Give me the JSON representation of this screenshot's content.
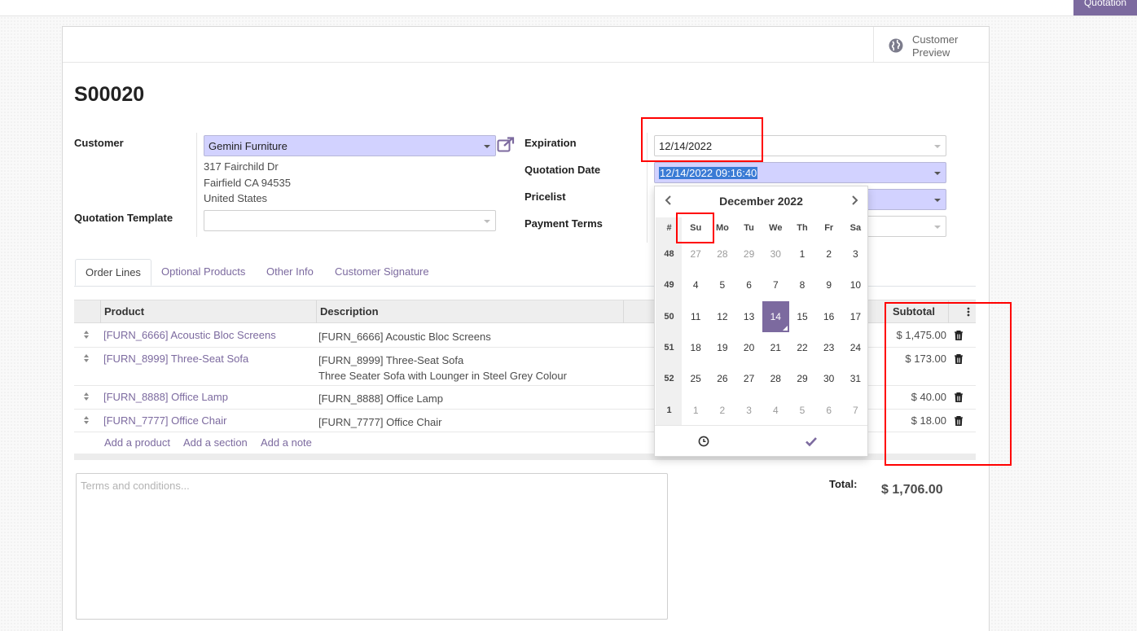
{
  "topbar": {
    "quotation_button": "Quotation"
  },
  "header": {
    "customer_preview": "Customer Preview"
  },
  "record": {
    "title": "S00020"
  },
  "form": {
    "customer_label": "Customer",
    "customer_value": "Gemini Furniture",
    "address": [
      "317 Fairchild Dr",
      "Fairfield CA 94535",
      "United States"
    ],
    "template_label": "Quotation Template",
    "template_value": "",
    "expiration_label": "Expiration",
    "expiration_value": "12/14/2022",
    "quotation_date_label": "Quotation Date",
    "quotation_date_value": "12/14/2022 09:16:40",
    "pricelist_label": "Pricelist",
    "payment_terms_label": "Payment Terms"
  },
  "tabs": [
    "Order Lines",
    "Optional Products",
    "Other Info",
    "Customer Signature"
  ],
  "table": {
    "headers": {
      "product": "Product",
      "description": "Description",
      "subtotal": "Subtotal"
    },
    "rows": [
      {
        "product": "[FURN_6666] Acoustic Bloc Screens",
        "description": "[FURN_6666] Acoustic Bloc Screens",
        "description2": "",
        "subtotal": "$ 1,475.00"
      },
      {
        "product": "[FURN_8999] Three-Seat Sofa",
        "description": "[FURN_8999] Three-Seat Sofa",
        "description2": "Three Seater Sofa with Lounger in Steel Grey Colour",
        "subtotal": "$ 173.00"
      },
      {
        "product": "[FURN_8888] Office Lamp",
        "description": "[FURN_8888] Office Lamp",
        "description2": "",
        "subtotal": "$ 40.00"
      },
      {
        "product": "[FURN_7777] Office Chair",
        "description": "[FURN_7777] Office Chair",
        "description2": "",
        "subtotal": "$ 18.00"
      }
    ],
    "add_product": "Add a product",
    "add_section": "Add a section",
    "add_note": "Add a note"
  },
  "terms": {
    "placeholder": "Terms and conditions..."
  },
  "totals": {
    "label": "Total:",
    "value": "$ 1,706.00"
  },
  "datepicker": {
    "title": "December 2022",
    "week_header": "#",
    "days_of_week": [
      "Su",
      "Mo",
      "Tu",
      "We",
      "Th",
      "Fr",
      "Sa"
    ],
    "weeks": [
      {
        "num": "48",
        "days": [
          "27",
          "28",
          "29",
          "30",
          "1",
          "2",
          "3"
        ]
      },
      {
        "num": "49",
        "days": [
          "4",
          "5",
          "6",
          "7",
          "8",
          "9",
          "10"
        ]
      },
      {
        "num": "50",
        "days": [
          "11",
          "12",
          "13",
          "14",
          "15",
          "16",
          "17"
        ]
      },
      {
        "num": "51",
        "days": [
          "18",
          "19",
          "20",
          "21",
          "22",
          "23",
          "24"
        ]
      },
      {
        "num": "52",
        "days": [
          "25",
          "26",
          "27",
          "28",
          "29",
          "30",
          "31"
        ]
      },
      {
        "num": "1",
        "days": [
          "1",
          "2",
          "3",
          "4",
          "5",
          "6",
          "7"
        ]
      }
    ],
    "selected_day": "14",
    "accent_color": "#7c6a9f"
  },
  "colors": {
    "brand": "#7c6a9f",
    "required_field": "#d2d2ff",
    "highlight": "#ff0000"
  }
}
